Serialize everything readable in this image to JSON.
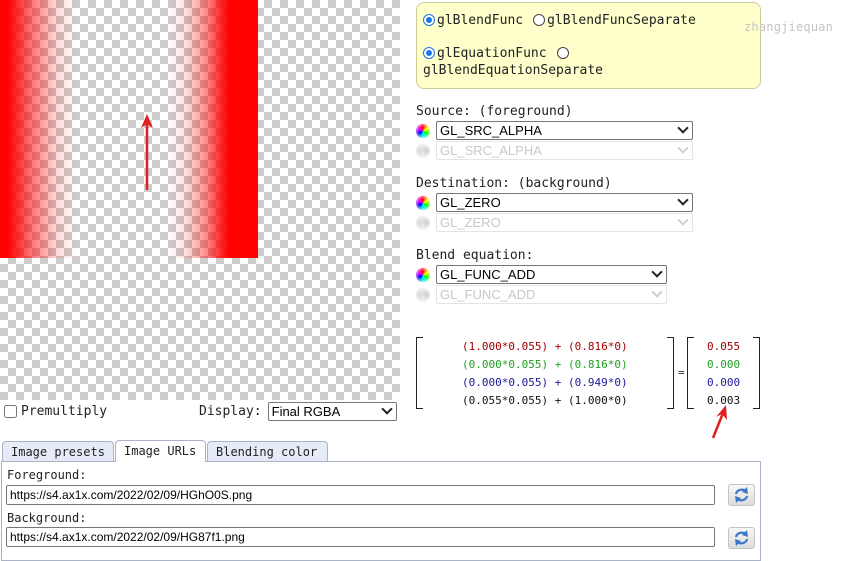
{
  "func_box": {
    "blend_func": {
      "label": "glBlendFunc",
      "selected": true
    },
    "blend_func_separate": {
      "label": "glBlendFuncSeparate",
      "selected": false
    },
    "equation": {
      "label": "glEquationFunc",
      "selected": true
    },
    "equation_separate": {
      "label": "glBlendEquationSeparate",
      "selected": false
    }
  },
  "watermark": "zhangjiequan",
  "source": {
    "label": "Source: (foreground)",
    "rgb_value": "GL_SRC_ALPHA",
    "alpha_value": "GL_SRC_ALPHA"
  },
  "destination": {
    "label": "Destination: (background)",
    "rgb_value": "GL_ZERO",
    "alpha_value": "GL_ZERO"
  },
  "equation": {
    "label": "Blend equation:",
    "rgb_value": "GL_FUNC_ADD",
    "alpha_value": "GL_FUNC_ADD"
  },
  "matrix": {
    "rows": [
      {
        "expr": "(1.000*0.055) + (0.816*0)",
        "result": "0.055",
        "color": "#a00000"
      },
      {
        "expr": "(0.000*0.055) + (0.816*0)",
        "result": "0.000",
        "color": "#20a020"
      },
      {
        "expr": "(0.000*0.055) + (0.949*0)",
        "result": "0.000",
        "color": "#1a1a9a"
      },
      {
        "expr": "(0.055*0.055) + (1.000*0)",
        "result": "0.003",
        "color": "#111111"
      }
    ],
    "equals": "="
  },
  "canvas_controls": {
    "premultiply_label": "Premultiply",
    "premultiply_checked": false,
    "display_label": "Display:",
    "display_value": "Final RGBA"
  },
  "tabs": [
    {
      "label": "Image presets",
      "active": false
    },
    {
      "label": "Image URLs",
      "active": true
    },
    {
      "label": "Blending color",
      "active": false
    }
  ],
  "urls": {
    "foreground_label": "Foreground:",
    "foreground_value": "https://s4.ax1x.com/2022/02/09/HGhO0S.png",
    "background_label": "Background:",
    "background_value": "https://s4.ax1x.com/2022/02/09/HG87f1.png"
  },
  "colors": {
    "func_box_bg": "#ffffcc",
    "radio_accent": "#1a73e8",
    "foreground_red": "#ff0000",
    "annotation_red": "#e02020"
  },
  "icons": {
    "color_wheel": "color-wheel-icon",
    "reload": "reload-icon"
  }
}
